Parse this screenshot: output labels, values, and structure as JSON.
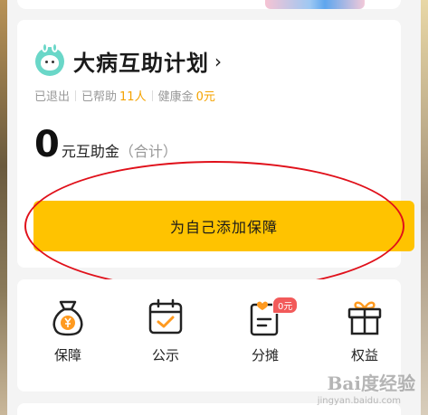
{
  "plan": {
    "title": "大病互助计划",
    "chevron": "›",
    "status": "已退出",
    "helped_label": "已帮助",
    "helped_value": "11人",
    "health_fund_label": "健康金",
    "health_fund_value": "0元"
  },
  "amount": {
    "value": "0",
    "unit": "元互助金",
    "note": "（合计）"
  },
  "add_button_label": "为自己添加保障",
  "shortcuts": [
    {
      "label": "保障",
      "icon": "money-bag-icon"
    },
    {
      "label": "公示",
      "icon": "calendar-check-icon"
    },
    {
      "label": "分摊",
      "icon": "document-heart-icon",
      "badge": "0元"
    },
    {
      "label": "权益",
      "icon": "gift-icon"
    }
  ],
  "colors": {
    "accent": "#ffc300",
    "highlight_number": "#f5a300",
    "badge": "#f25a5a",
    "icon_orange": "#ff9a1f",
    "annotation": "#e0101a"
  },
  "watermark": {
    "main": "Bai度经验",
    "sub": "jingyan.baidu.com"
  }
}
